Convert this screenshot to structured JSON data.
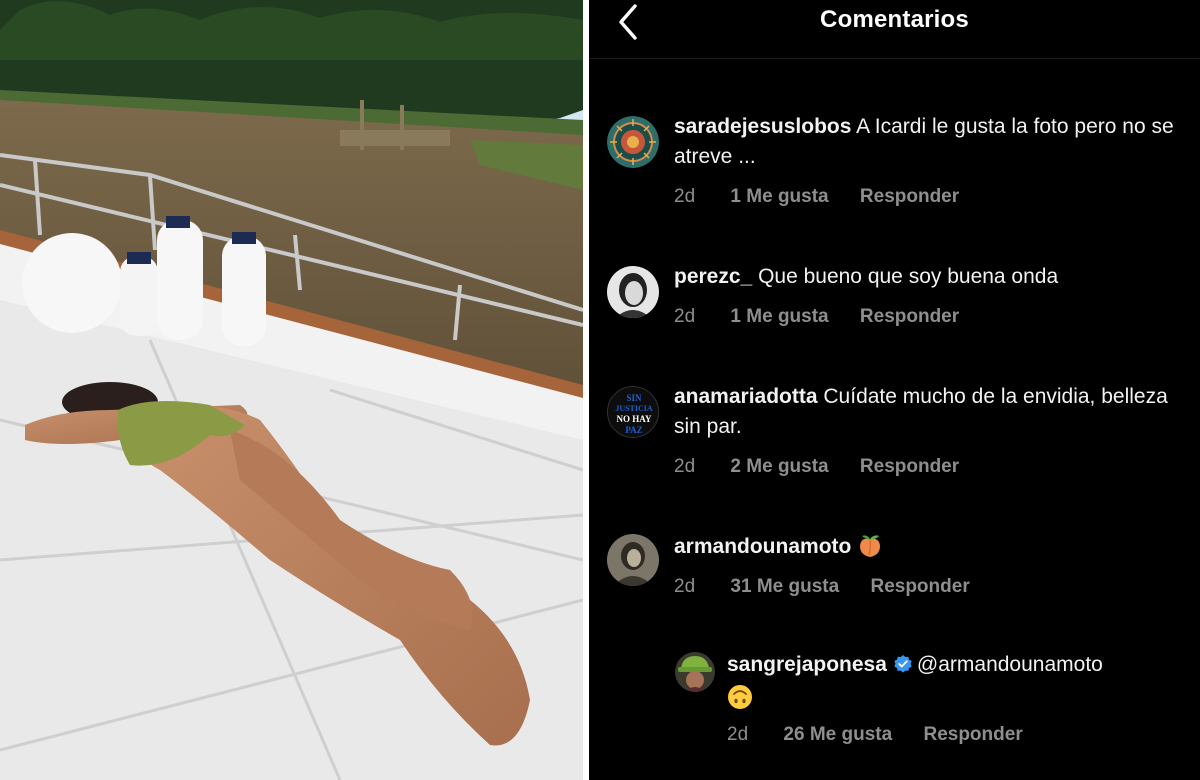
{
  "header": {
    "title": "Comentarios",
    "back_icon": "chevron-left-icon"
  },
  "colors": {
    "background": "#000000",
    "text": "#ffffff",
    "meta": "#8e8e8e",
    "verified": "#3897f0"
  },
  "photo": {
    "description_icon": "photo-image"
  },
  "comments": [
    {
      "username": "saradejesuslobos",
      "text": "A Icardi le gusta la foto pero no se atreve ...",
      "time": "2d",
      "likes": "1 Me gusta",
      "reply": "Responder"
    },
    {
      "username": "perezc_",
      "text": "Que bueno que soy buena onda",
      "time": "2d",
      "likes": "1 Me gusta",
      "reply": "Responder"
    },
    {
      "username": "anamariadotta",
      "text": "Cuídate mucho de la envidia, belleza sin par.",
      "time": "2d",
      "likes": "2 Me gusta",
      "reply": "Responder",
      "avatar_text": [
        "SIN",
        "JUSTICIA",
        "NO HAY",
        "PAZ"
      ]
    },
    {
      "username": "armandounamoto",
      "text": "",
      "emoji": "peach-emoji",
      "time": "2d",
      "likes": "31 Me gusta",
      "reply": "Responder"
    }
  ],
  "reply": {
    "username": "sangrejaponesa",
    "verified": true,
    "mention": "@armandounamoto",
    "emoji": "upside-down-face-emoji",
    "time": "2d",
    "likes": "26 Me gusta",
    "reply": "Responder"
  }
}
